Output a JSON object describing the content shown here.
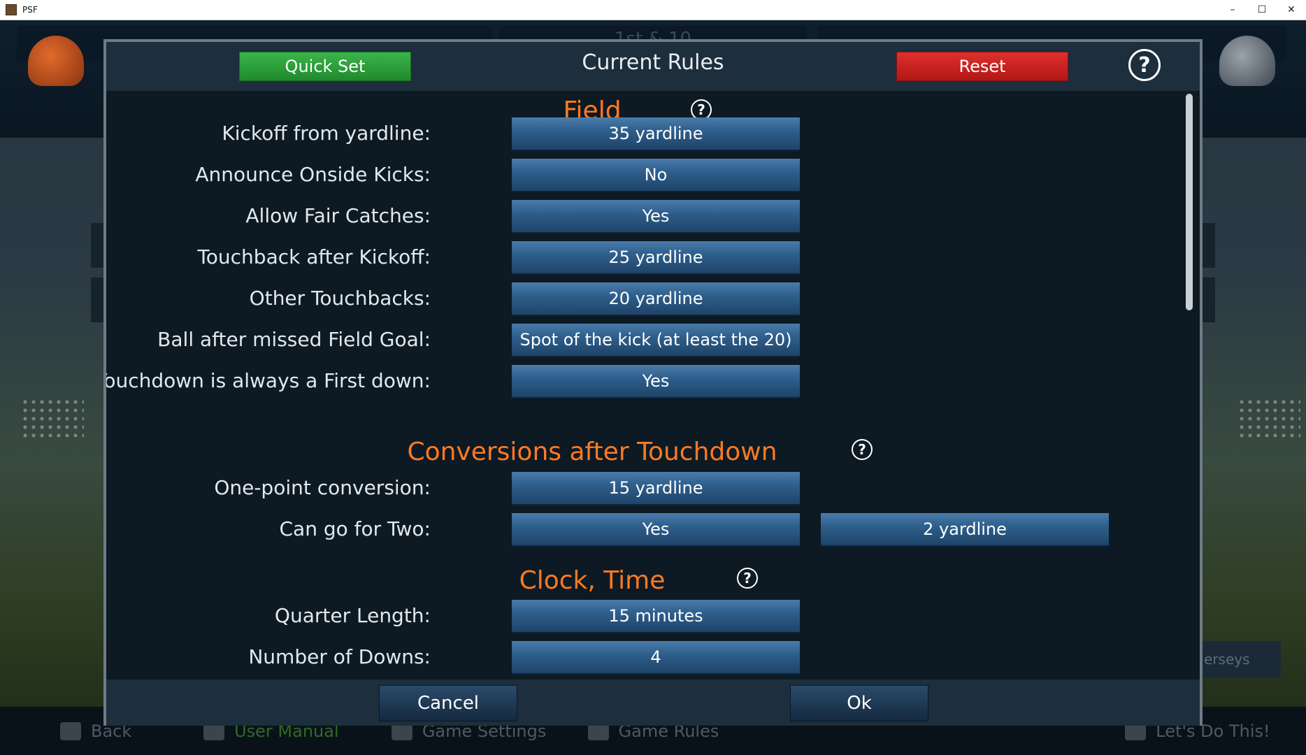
{
  "window": {
    "title": "PSF",
    "minimize_glyph": "–",
    "maximize_glyph": "☐",
    "close_glyph": "✕"
  },
  "background": {
    "down_distance": "1st & 10",
    "jerseys_label": "erseys",
    "nav": [
      {
        "label": "Back",
        "icon": "back-arrow-icon"
      },
      {
        "label": "User Manual",
        "icon": "manual-icon"
      },
      {
        "label": "Game Settings",
        "icon": "gear-icon"
      },
      {
        "label": "Game Rules",
        "icon": "rules-icon"
      },
      {
        "label": "Let's Do This!",
        "icon": "helmet-icon"
      }
    ]
  },
  "dialog": {
    "title": "Current Rules",
    "quick_set_label": "Quick Set",
    "reset_label": "Reset",
    "help_glyph": "?",
    "cancel_label": "Cancel",
    "ok_label": "Ok"
  },
  "sections": {
    "field": {
      "title": "Field",
      "rows": [
        {
          "label": "Kickoff from yardline:",
          "value": "35 yardline"
        },
        {
          "label": "Announce Onside Kicks:",
          "value": "No"
        },
        {
          "label": "Allow Fair Catches:",
          "value": "Yes"
        },
        {
          "label": "Touchback after Kickoff:",
          "value": "25 yardline"
        },
        {
          "label": "Other Touchbacks:",
          "value": "20 yardline"
        },
        {
          "label": "Ball after missed Field Goal:",
          "value": "Spot of the kick (at least the 20)"
        },
        {
          "label": "Touchdown is always a First down:",
          "value": "Yes"
        }
      ]
    },
    "conversions": {
      "title": "Conversions after Touchdown",
      "rows": [
        {
          "label": "One-point conversion:",
          "value": "15 yardline"
        },
        {
          "label": "Can go for Two:",
          "value": "Yes",
          "value2": "2 yardline"
        }
      ]
    },
    "clock": {
      "title": "Clock, Time",
      "rows": [
        {
          "label": "Quarter Length:",
          "value": "15 minutes"
        },
        {
          "label": "Number of Downs:",
          "value": "4"
        }
      ]
    }
  },
  "colors": {
    "section_title": "#ff7a21",
    "quick_set": "#2aa13b",
    "reset": "#cc2220",
    "value_button": "#2f5f8c"
  }
}
